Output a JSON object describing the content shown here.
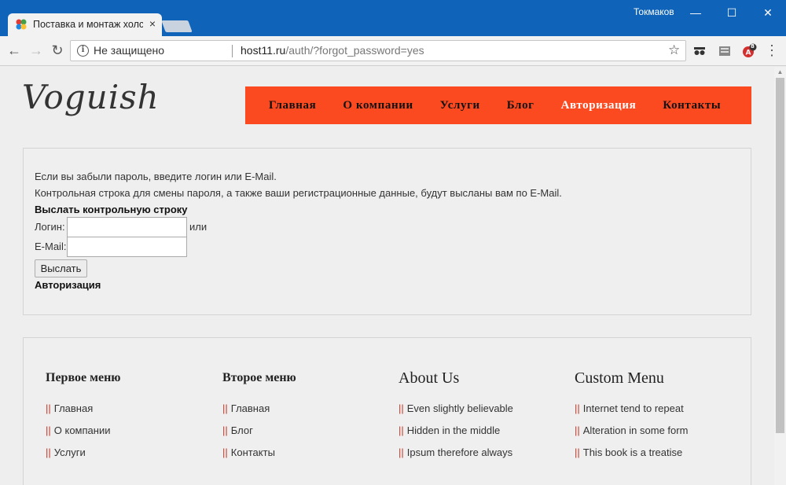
{
  "browser": {
    "tab_title": "Поставка и монтаж холс",
    "tab_close": "×",
    "user": "Токмаков",
    "window_buttons": {
      "minimize": "—",
      "maximize": "☐",
      "close": "✕"
    },
    "nav": {
      "back": "←",
      "forward": "→",
      "reload": "↻"
    },
    "security_label": "Не защищено",
    "url_host": "host11.ru",
    "url_path": "/auth/?forgot_password=yes",
    "bookmark_star": "☆",
    "menu_dots": "⋮",
    "ext_badge": "8"
  },
  "site": {
    "logo": "Voguish",
    "nav": [
      "Главная",
      "О компании",
      "Услуги",
      "Блог",
      "Авторизация",
      "Контакты"
    ],
    "nav_active_index": 4,
    "accent_color": "#fb4920"
  },
  "auth": {
    "intro1": "Если вы забыли пароль, введите логин или E-Mail.",
    "intro2": "Контрольная строка для смены пароля, а также ваши регистрационные данные, будут высланы вам по E-Mail.",
    "heading": "Выслать контрольную строку",
    "login_label": "Логин:",
    "or_label": "или",
    "email_label": "E-Mail:",
    "login_value": "",
    "email_value": "",
    "submit": "Выслать",
    "auth_link": "Авторизация"
  },
  "footer": {
    "columns": [
      {
        "title": "Первое меню",
        "items": [
          "Главная",
          "О компании",
          "Услуги"
        ]
      },
      {
        "title": "Второе меню",
        "items": [
          "Главная",
          "Блог",
          "Контакты"
        ]
      },
      {
        "title": "About Us",
        "items": [
          "Even slightly believable",
          "Hidden in the middle",
          "Ipsum therefore always"
        ]
      },
      {
        "title": "Custom Menu",
        "items": [
          "Internet tend to repeat",
          "Alteration in some form",
          "This book is a treatise"
        ]
      }
    ],
    "bullet": "||"
  }
}
